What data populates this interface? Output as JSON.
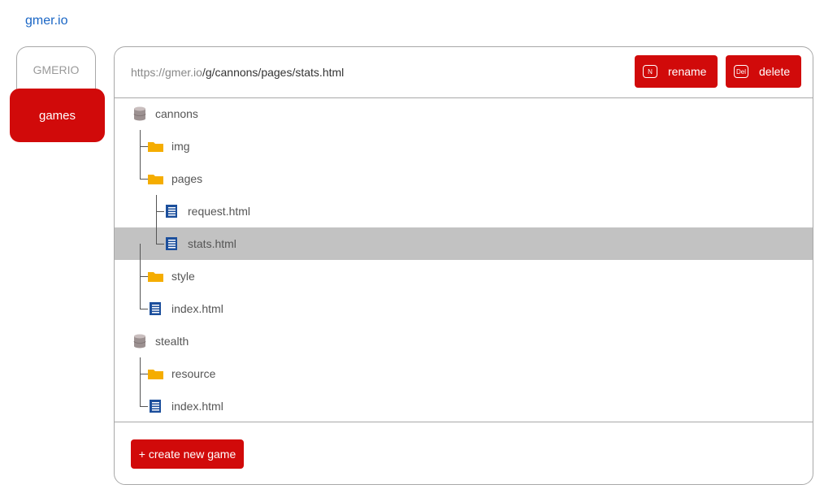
{
  "header": {
    "logo_text": "gmer.io"
  },
  "tabs": {
    "gmerio_label": "GMERIO",
    "games_label": "games"
  },
  "path": {
    "prefix": "https://gmer.io",
    "rest": "/g/cannons/pages/stats.html"
  },
  "toolbar": {
    "rename_key": "N",
    "rename_label": "rename",
    "delete_key": "Del",
    "delete_label": "delete"
  },
  "tree": {
    "cannons": "cannons",
    "cannons_img": "img",
    "cannons_pages": "pages",
    "cannons_request": "request.html",
    "cannons_stats": "stats.html",
    "cannons_style": "style",
    "cannons_index": "index.html",
    "stealth": "stealth",
    "stealth_resource": "resource",
    "stealth_index": "index.html"
  },
  "footer": {
    "create_label": "+ create new game"
  },
  "colors": {
    "accent": "#d10a0a",
    "link": "#1a66c5",
    "folder": "#f5ad00",
    "file": "#1c4f9c",
    "selected": "#c2c2c2"
  }
}
